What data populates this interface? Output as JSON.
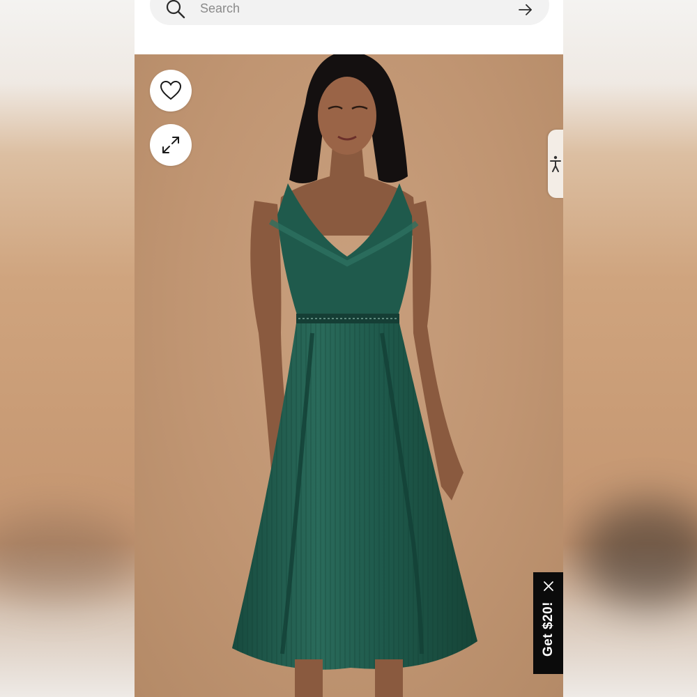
{
  "search": {
    "placeholder": "Search"
  },
  "icons": {
    "search": "search-icon",
    "submit": "arrow-right-icon",
    "favorite": "heart-icon",
    "expand": "expand-icon",
    "accessibility": "accessibility-icon",
    "close": "close-icon"
  },
  "promo": {
    "label": "Get $20!"
  },
  "colors": {
    "photo_background": "#c09572",
    "dress": "#1f5a4c",
    "promo_background": "#0b0b0b",
    "search_background": "#f2f2f2"
  }
}
